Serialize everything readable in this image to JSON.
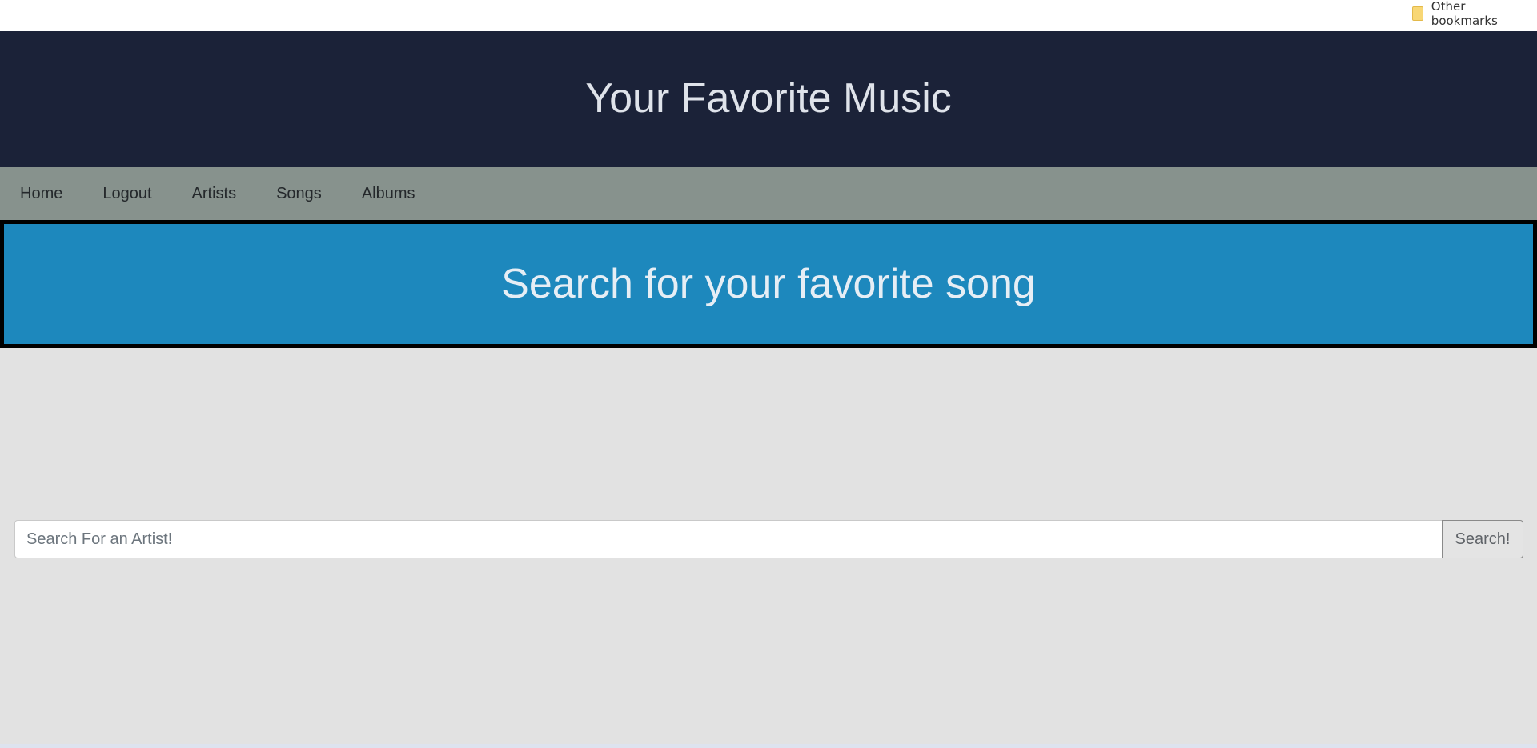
{
  "bookmarks_bar": {
    "other_bookmarks_label": "Other bookmarks",
    "folder_icon": "folder-icon"
  },
  "header": {
    "title": "Your Favorite Music",
    "background": "#1b2238"
  },
  "nav": {
    "items": [
      {
        "label": "Home"
      },
      {
        "label": "Logout"
      },
      {
        "label": "Artists"
      },
      {
        "label": "Songs"
      },
      {
        "label": "Albums"
      }
    ],
    "background": "#87928d"
  },
  "banner": {
    "heading": "Search for your favorite song",
    "background": "#1d88bd"
  },
  "search": {
    "placeholder": "Search For an Artist!",
    "value": "",
    "button_label": "Search!"
  }
}
